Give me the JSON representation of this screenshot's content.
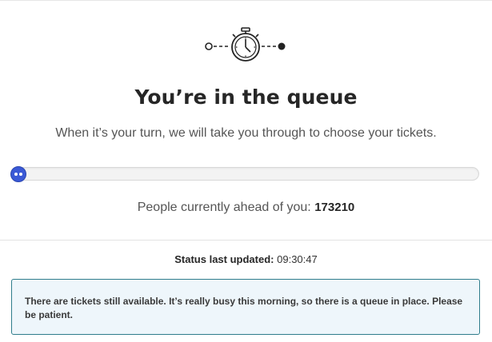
{
  "queue": {
    "title": "You’re in the queue",
    "subtitle": "When it’s your turn, we will take you through to choose your tickets.",
    "progress_fraction": 0.02,
    "ahead_label": "People currently ahead of you:",
    "ahead_count": "173210"
  },
  "status": {
    "label": "Status last updated:",
    "time": "09:30:47"
  },
  "notice": {
    "text": "There are tickets still available. It’s really busy this morning, so there is a queue in place. Please be patient."
  },
  "icons": {
    "header": "stopwatch-icon",
    "progress": "progress-knob"
  },
  "colors": {
    "accent": "#3a59d6",
    "notice_border": "#2f7d8c",
    "notice_bg": "#eef6fb"
  }
}
